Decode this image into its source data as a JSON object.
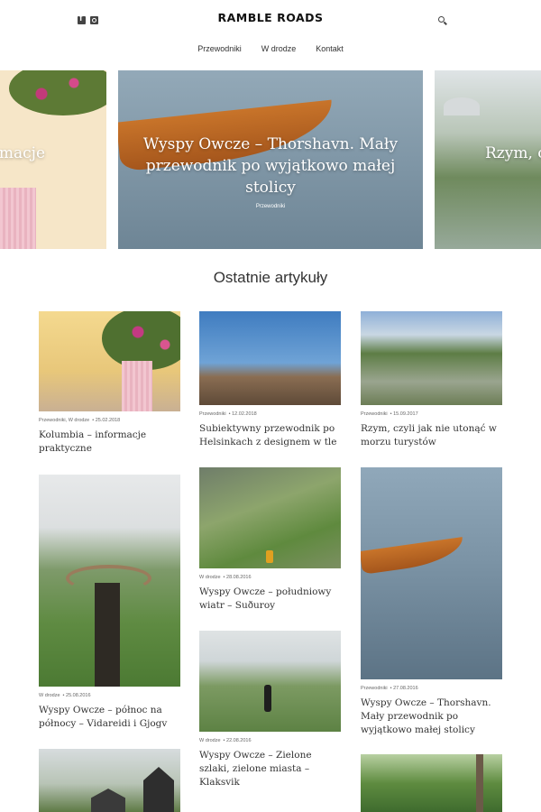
{
  "header": {
    "logo": "RAMBLE ROADS",
    "social_icons": [
      "facebook-icon",
      "instagram-icon"
    ],
    "search_icon": "search-icon",
    "nav": [
      "Przewodniki",
      "W drodze",
      "Kontakt"
    ]
  },
  "slider": {
    "left": {
      "title": "macje"
    },
    "main": {
      "title": "Wyspy Owcze – Thorshavn. Mały przewodnik po wyjątkowo małej stolicy",
      "category": "Przewodniki"
    },
    "right": {
      "title": "Rzym, c"
    }
  },
  "section": {
    "title": "Ostatnie artykuły"
  },
  "articles": [
    {
      "categories": "Przewodniki, W drodze",
      "date": "25.02.2018",
      "title": "Kolumbia – informacje praktyczne"
    },
    {
      "categories": "Przewodniki",
      "date": "12.02.2018",
      "title": "Subiektywny przewodnik po Helsinkach z designem w tle"
    },
    {
      "categories": "Przewodniki",
      "date": "15.09.2017",
      "title": "Rzym, czyli jak nie utonąć w morzu turystów"
    },
    {
      "categories": "W drodze",
      "date": "25.08.2016",
      "title": "Wyspy Owcze – północ na północy – Vidareidi i Gjogv"
    },
    {
      "categories": "W drodze",
      "date": "28.08.2016",
      "title": "Wyspy Owcze – południowy wiatr – Suðuroy"
    },
    {
      "categories": "Przewodniki",
      "date": "27.08.2016",
      "title": "Wyspy Owcze – Thorshavn. Mały przewodnik po wyjątkowo małej stolicy"
    },
    {
      "categories": "W drodze",
      "date": "22.08.2016",
      "title": "Wyspy Owcze – Zielone szlaki, zielone miasta – Klaksvik"
    }
  ],
  "colors": {
    "text": "#333333",
    "meta": "#666666",
    "background": "#ffffff"
  }
}
